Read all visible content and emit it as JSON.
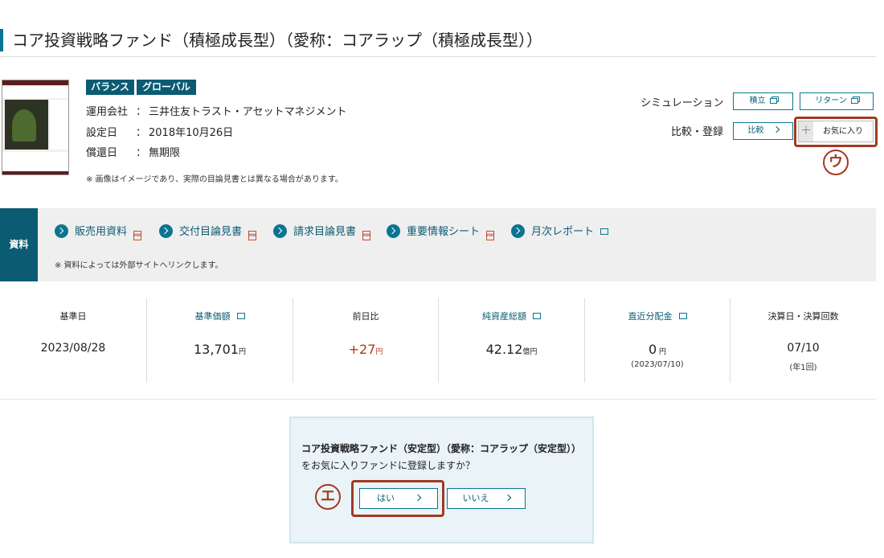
{
  "fund": {
    "title": "コア投資戦略ファンド（積極成長型）（愛称：コアラップ（積極成長型））",
    "tags": [
      "バランス",
      "グローバル"
    ],
    "info": [
      {
        "label": "運用会社",
        "sep": "：",
        "value": "三井住友トラスト・アセットマネジメント"
      },
      {
        "label": "設定日",
        "sep": "：",
        "value": "2018年10月26日"
      },
      {
        "label": "償還日",
        "sep": "：",
        "value": "無期限"
      }
    ],
    "image_note": "※ 画像はイメージであり、実際の目論見書とは異なる場合があります。"
  },
  "actions": {
    "simulation_label": "シミュレーション",
    "tsumitate": "積立",
    "return": "リターン",
    "compare_label": "比較・登録",
    "compare": "比較",
    "favorite": "お気に入り",
    "favorite_plus": "＋"
  },
  "markers": {
    "u": "ウ",
    "e": "エ"
  },
  "docs": {
    "heading": "資料",
    "links": [
      "販売用資料",
      "交付目論見書",
      "請求目論見書",
      "重要情報シート",
      "月次レポート"
    ],
    "pdf_text": "PDF",
    "note": "※ 資料によっては外部サイトへリンクします。"
  },
  "stats": [
    {
      "label": "基準日",
      "value": "2023/08/28",
      "unit": "",
      "sub": ""
    },
    {
      "label": "基準価額",
      "value": "13,701",
      "unit": "円",
      "sub": ""
    },
    {
      "label": "前日比",
      "value": "+27",
      "unit": "円",
      "sub": ""
    },
    {
      "label": "純資産総額",
      "value": "42.12",
      "unit": "億円",
      "sub": ""
    },
    {
      "label": "直近分配金",
      "value": "0",
      "unit": " 円",
      "sub": "(2023/07/10)"
    },
    {
      "label": "決算日・決算回数",
      "value": "07/10",
      "unit": "",
      "sub": "(年1回)"
    }
  ],
  "dialog": {
    "fund_name": "コア投資戦略ファンド（安定型）（愛称：コアラップ（安定型））",
    "question": "をお気に入りファンドに登録しますか？",
    "yes": "はい",
    "no": "いいえ"
  },
  "colors": {
    "accent": "#0b7591",
    "dark_accent": "#0b5b72",
    "highlight": "#a13a22",
    "positive": "#b1381f"
  }
}
